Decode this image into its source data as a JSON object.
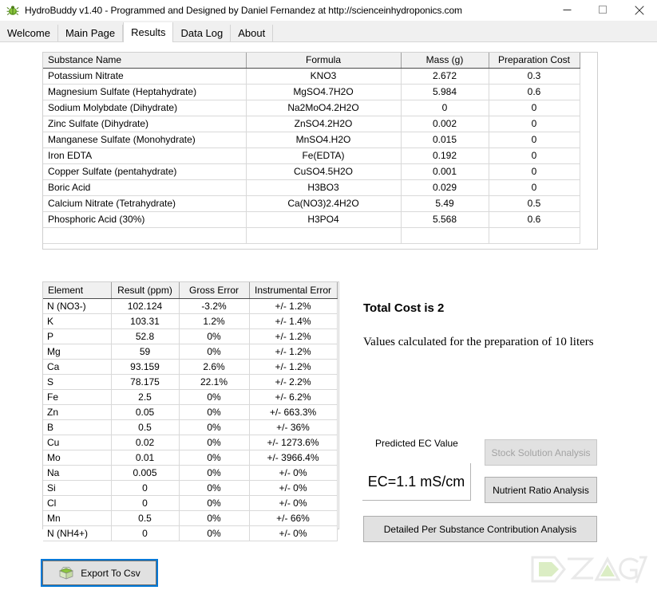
{
  "window": {
    "title": "HydroBuddy v1.40 - Programmed and Designed by Daniel Fernandez at http://scienceinhydroponics.com",
    "app_icon": "bug-icon",
    "minimize_label": "—",
    "maximize_label": "□",
    "close_label": "✕"
  },
  "tabs": [
    {
      "label": "Welcome",
      "active": false
    },
    {
      "label": "Main Page",
      "active": false
    },
    {
      "label": "Results",
      "active": true
    },
    {
      "label": "Data Log",
      "active": false
    },
    {
      "label": "About",
      "active": false
    }
  ],
  "substance_table": {
    "headers": [
      "Substance Name",
      "Formula",
      "Mass (g)",
      "Preparation Cost"
    ],
    "rows": [
      [
        "Potassium Nitrate",
        "KNO3",
        "2.672",
        "0.3"
      ],
      [
        "Magnesium Sulfate (Heptahydrate)",
        "MgSO4.7H2O",
        "5.984",
        "0.6"
      ],
      [
        "Sodium Molybdate (Dihydrate)",
        "Na2MoO4.2H2O",
        "0",
        "0"
      ],
      [
        "Zinc Sulfate (Dihydrate)",
        "ZnSO4.2H2O",
        "0.002",
        "0"
      ],
      [
        "Manganese Sulfate (Monohydrate)",
        "MnSO4.H2O",
        "0.015",
        "0"
      ],
      [
        "Iron EDTA",
        "Fe(EDTA)",
        "0.192",
        "0"
      ],
      [
        "Copper Sulfate (pentahydrate)",
        "CuSO4.5H2O",
        "0.001",
        "0"
      ],
      [
        "Boric Acid",
        "H3BO3",
        "0.029",
        "0"
      ],
      [
        "Calcium Nitrate (Tetrahydrate)",
        "Ca(NO3)2.4H2O",
        "5.49",
        "0.5"
      ],
      [
        "Phosphoric Acid (30%)",
        "H3PO4",
        "5.568",
        "0.6"
      ],
      [
        "",
        "",
        "",
        ""
      ]
    ]
  },
  "element_table": {
    "headers": [
      "Element",
      "Result (ppm)",
      "Gross Error",
      "Instrumental Error"
    ],
    "rows": [
      [
        "N (NO3-)",
        "102.124",
        "-3.2%",
        "+/- 1.2%"
      ],
      [
        "K",
        "103.31",
        "1.2%",
        "+/- 1.4%"
      ],
      [
        "P",
        "52.8",
        "0%",
        "+/- 1.2%"
      ],
      [
        "Mg",
        "59",
        "0%",
        "+/- 1.2%"
      ],
      [
        "Ca",
        "93.159",
        "2.6%",
        "+/- 1.2%"
      ],
      [
        "S",
        "78.175",
        "22.1%",
        "+/- 2.2%"
      ],
      [
        "Fe",
        "2.5",
        "0%",
        "+/- 6.2%"
      ],
      [
        "Zn",
        "0.05",
        "0%",
        "+/- 663.3%"
      ],
      [
        "B",
        "0.5",
        "0%",
        "+/- 36%"
      ],
      [
        "Cu",
        "0.02",
        "0%",
        "+/- 1273.6%"
      ],
      [
        "Mo",
        "0.01",
        "0%",
        "+/- 3966.4%"
      ],
      [
        "Na",
        "0.005",
        "0%",
        "+/- 0%"
      ],
      [
        "Si",
        "0",
        "0%",
        "+/- 0%"
      ],
      [
        "Cl",
        "0",
        "0%",
        "+/- 0%"
      ],
      [
        "Mn",
        "0.5",
        "0%",
        "+/- 66%"
      ],
      [
        "N (NH4+)",
        "0",
        "0%",
        "+/- 0%"
      ]
    ]
  },
  "summary": {
    "total_cost": "Total Cost is 2",
    "preparation_note": "Values calculated for the preparation of 10 liters",
    "ec_label": "Predicted EC Value",
    "ec_value": "EC=1.1 mS/cm"
  },
  "buttons": {
    "stock_solution": "Stock Solution Analysis",
    "nutrient_ratio": "Nutrient Ratio Analysis",
    "detailed_contribution": "Detailed Per Substance Contribution Analysis",
    "export_csv": "Export To Csv",
    "export_icon": "package-box-icon"
  },
  "colors": {
    "accent_focus": "#0078d7",
    "button_face": "#e1e1e1",
    "header_face": "#f0f0f0",
    "grid_line": "#d9d9d9",
    "disabled_text": "#a3a3a3"
  },
  "watermark": {
    "text": "DZAG"
  }
}
